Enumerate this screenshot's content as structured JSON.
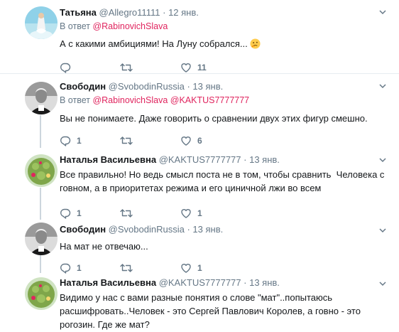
{
  "tweets": [
    {
      "name": "Татьяна",
      "handle": "@Allegro11111",
      "dot": "·",
      "date": "12 янв.",
      "reply_prefix": "В ответ",
      "reply_mentions": [
        "@RabinovichSlava"
      ],
      "text": "А с какими амбициями! На Луну собрался...",
      "emoji": "thinking-face-icon",
      "replies": "",
      "retweets": "",
      "likes": "11"
    },
    {
      "name": "Свободин",
      "handle": "@SvobodinRussia",
      "dot": "·",
      "date": "13 янв.",
      "reply_prefix": "В ответ",
      "reply_mentions": [
        "@RabinovichSlava",
        "@KAKTUS7777777"
      ],
      "text": "Вы не понимаете. Даже говорить о сравнении двух этих фигур смешно.",
      "replies": "1",
      "retweets": "",
      "likes": "6"
    },
    {
      "name": "Наталья Васильевна",
      "handle": "@KAKTUS7777777",
      "dot": "·",
      "date": "13 янв.",
      "text_line1": "Все правильно! Но ведь смысл поста не в том, чтобы сравнить  Человека с",
      "text_line2": "говном, а в приоритетах режима и его циничной лжи во всем",
      "replies": "1",
      "retweets": "",
      "likes": "1"
    },
    {
      "name": "Свободин",
      "handle": "@SvobodinRussia",
      "dot": "·",
      "date": "13 янв.",
      "text": "На мат не отвечаю...",
      "replies": "1",
      "retweets": "",
      "likes": "1"
    },
    {
      "name": "Наталья Васильевна",
      "handle": "@KAKTUS7777777",
      "dot": "·",
      "date": "13 янв.",
      "text_line1": "Видимо у нас с вами разные понятия о слове \"мат\"..попытаюсь",
      "text_line2": "расшифровать..Человек - это Сергей Павлович Королев, а говно - это",
      "text_line3": "рогозин. Где же мат?"
    }
  ],
  "colors": {
    "name": "#14171a",
    "secondary": "#657786",
    "mention": "#e0245e",
    "thread_line": "#ccd6dd",
    "divider": "#e6ecf0"
  }
}
